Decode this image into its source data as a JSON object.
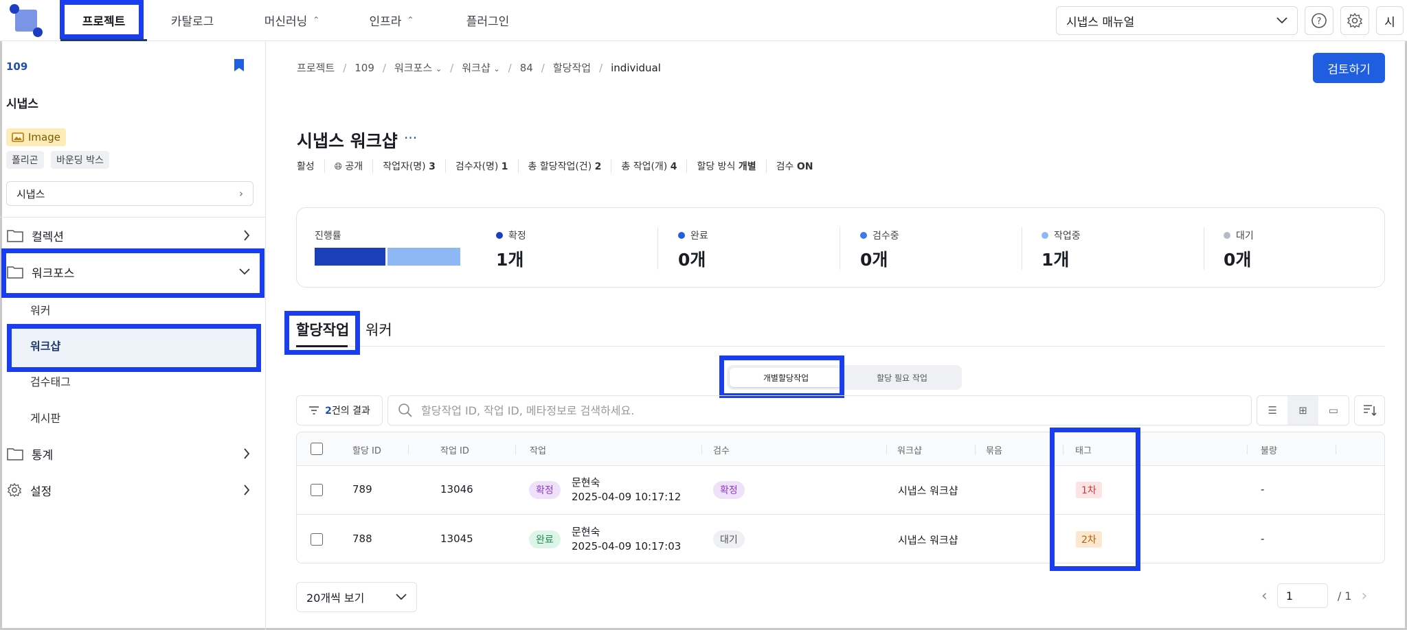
{
  "nav": {
    "items": [
      {
        "label": "프로젝트"
      },
      {
        "label": "카탈로그"
      },
      {
        "label": "머신러닝"
      },
      {
        "label": "인프라"
      },
      {
        "label": "플러그인"
      }
    ],
    "manual_select": "시냅스 매뉴얼",
    "avatar": "시"
  },
  "sidebar": {
    "project_id": "109",
    "project_name": "시냅스",
    "image_badge": "Image",
    "tags": [
      "폴리곤",
      "바운딩 박스"
    ],
    "dataset_select": "시냅스",
    "menu": {
      "collection": "컬렉션",
      "workforce": "워크포스",
      "worker": "워커",
      "workshop": "워크샵",
      "review_tag": "검수태그",
      "board": "게시판",
      "stats": "통계",
      "settings": "설정"
    }
  },
  "breadcrumb": [
    "프로젝트",
    "109",
    "워크포스",
    "워크샵",
    "84",
    "할당작업",
    "individual"
  ],
  "review_button": "검토하기",
  "title": "시냅스 워크샵",
  "meta": {
    "status": "활성",
    "visibility": "공개",
    "workers_label": "작업자(명)",
    "workers_value": "3",
    "reviewers_label": "검수자(명)",
    "reviewers_value": "1",
    "assignments_label": "총 할당작업(건)",
    "assignments_value": "2",
    "tasks_label": "총 작업(개)",
    "tasks_value": "4",
    "assign_method_label": "할당 방식",
    "assign_method_value": "개별",
    "review_label": "검수",
    "review_value": "ON"
  },
  "stats": {
    "progress_label": "진행률",
    "progress_fraction": 0.5,
    "items": [
      {
        "label": "확정",
        "value": "1개",
        "color": "#1d3cc4"
      },
      {
        "label": "완료",
        "value": "0개",
        "color": "#1f5ee0"
      },
      {
        "label": "검수중",
        "value": "0개",
        "color": "#3d7be8"
      },
      {
        "label": "작업중",
        "value": "1개",
        "color": "#8db8f5"
      },
      {
        "label": "대기",
        "value": "0개",
        "color": "#b6bcc6"
      }
    ]
  },
  "tabs": [
    "할당작업",
    "워커"
  ],
  "segment": [
    "개별할당작업",
    "할당 필요 작업"
  ],
  "filter": {
    "count": "2",
    "suffix": "건의 결과"
  },
  "search_placeholder": "할당작업 ID, 작업 ID, 메타정보로 검색하세요.",
  "table": {
    "headers": [
      "할당 ID",
      "작업 ID",
      "작업",
      "검수",
      "워크샵",
      "묶음",
      "태그",
      "불량"
    ],
    "rows": [
      {
        "assign_id": "789",
        "task_id": "13046",
        "task_status": "확정",
        "worker": "문현숙",
        "time": "2025-04-09 10:17:12",
        "review": "확정",
        "workshop": "시냅스 워크샵",
        "tag": "1차",
        "defect": "-"
      },
      {
        "assign_id": "788",
        "task_id": "13045",
        "task_status": "완료",
        "worker": "문현숙",
        "time": "2025-04-09 10:17:03",
        "review": "대기",
        "workshop": "시냅스 워크샵",
        "tag": "2차",
        "defect": "-"
      }
    ]
  },
  "pagination": {
    "page_size": "20개씩 보기",
    "page": "1",
    "total": "/ 1"
  }
}
